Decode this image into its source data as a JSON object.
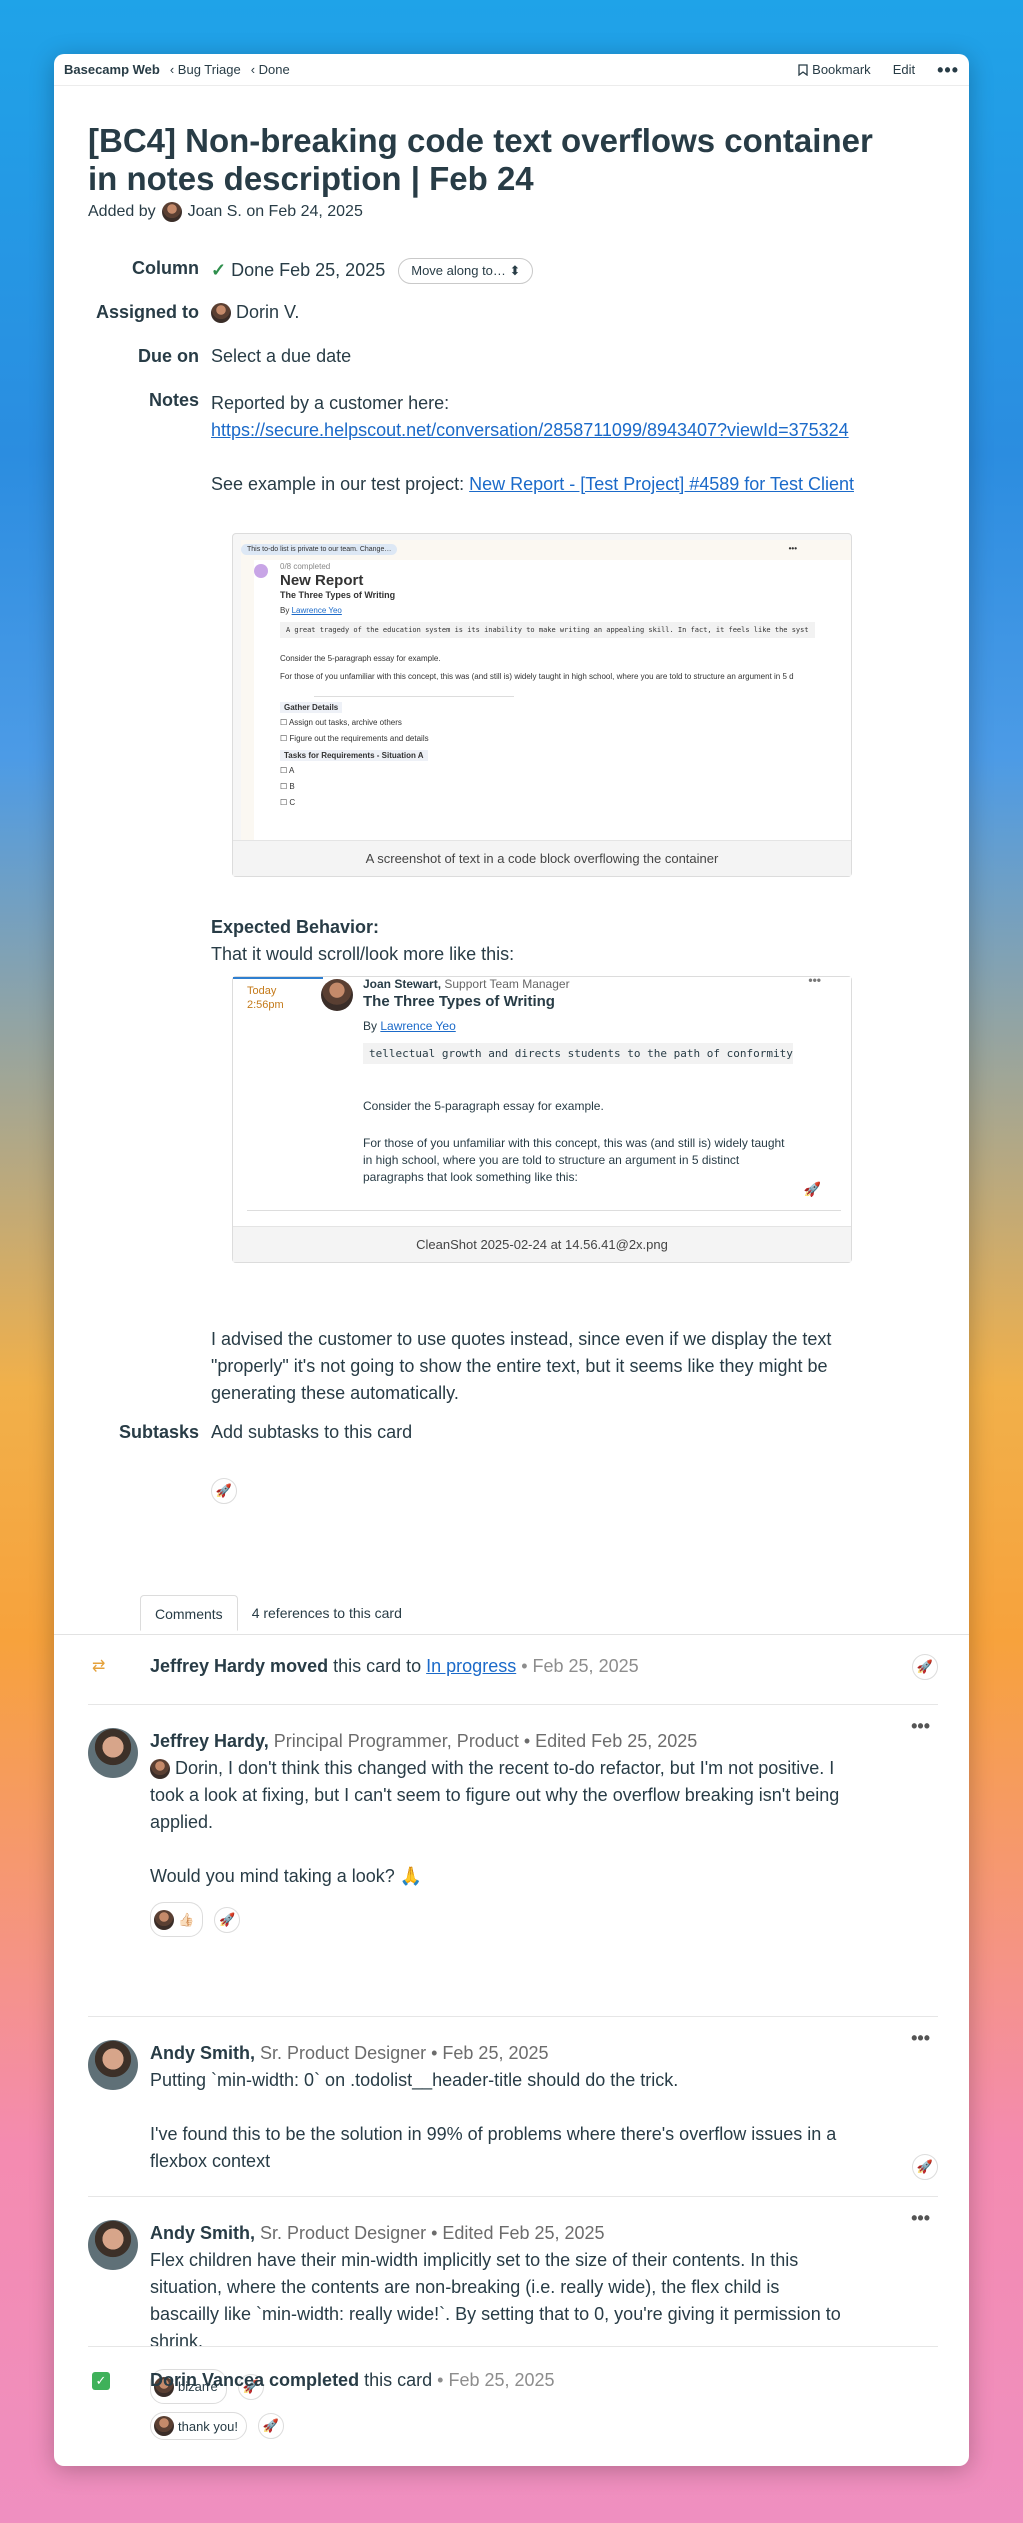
{
  "breadcrumb": {
    "home": "Basecamp Web",
    "project": "‹ Bug Triage",
    "column": "‹ Done"
  },
  "toolbar": {
    "bookmark": "Bookmark",
    "edit": "Edit",
    "more": "•••"
  },
  "card": {
    "title": "[BC4] Non-breaking code text overflows container in notes description | Feb 24",
    "added_by_prefix": "Added by",
    "added_by_rest": "Joan S. on Feb 24, 2025"
  },
  "fields": {
    "column_label": "Column",
    "column_value": "Done Feb 25, 2025",
    "move_button": "Move along to… ⬍",
    "assigned_label": "Assigned to",
    "assigned_value": "Dorin V.",
    "due_label": "Due on",
    "due_placeholder": "Select a due date",
    "notes_label": "Notes",
    "subtasks_label": "Subtasks",
    "subtasks_placeholder": "Add subtasks to this card"
  },
  "notes": {
    "line1": "Reported by a customer here:",
    "link1": "https://secure.helpscout.net/conversation/2858711099/8943407?viewId=375324",
    "line2_prefix": "See example in our test project:",
    "link2": "New Report - [Test Project] #4589 for Test Client",
    "shot1_caption": "A screenshot of text in a code block overflowing the container",
    "expected_heading": "Expected Behavior:",
    "expected_text": "That it would scroll/look more like this:",
    "shot2_caption": "CleanShot 2025-02-24 at 14.56.41@2x.png",
    "closing": "I advised the customer to use quotes instead, since even if we display the text \"properly\" it's not going to show the entire text, but it seems like they might be generating these automatically."
  },
  "shot1": {
    "private_note": "This to-do list is private to our team. Change…",
    "completed": "0/8 completed",
    "list_title": "New Report",
    "doc_title": "The Three Types of Writing",
    "by_label": "By",
    "author": "Lawrence Yeo",
    "code_line": "A great tragedy of the education system is its inability to make writing an appealing skill. In fact, it feels like the syst",
    "para1": "Consider the 5-paragraph essay for example.",
    "para2": "For those of you unfamiliar with this concept, this was (and still is) widely taught in high school, where you are told to structure an argument in 5 d",
    "group1": "Gather Details",
    "todo1": "Assign out tasks, archive others",
    "todo2": "Figure out the requirements and details",
    "group2": "Tasks for Requirements - Situation A",
    "todo3": "A",
    "todo4": "B",
    "todo5": "C"
  },
  "shot2": {
    "date": "Today",
    "time": "2:56pm",
    "author_name": "Joan Stewart,",
    "author_role": "Support Team Manager",
    "doc_title": "The Three Types of Writing",
    "by_label": "By",
    "author": "Lawrence Yeo",
    "code_line": "tellectual growth and directs students to the path of conformity.",
    "para1": "Consider the 5-paragraph essay for example.",
    "para2": "For those of you unfamiliar with this concept, this was (and still is) widely taught in high school, where you are told to structure an argument in 5 distinct paragraphs that look something like this:"
  },
  "tabs": [
    "Comments",
    "4 references to this card"
  ],
  "events": [
    {
      "actor": "Jeffrey Hardy moved",
      "text": "this card to",
      "link": "In progress",
      "date": "• Feb 25, 2025"
    },
    {
      "actor": "Dorin Vancea completed",
      "text": "this card",
      "date": "• Feb 25, 2025"
    }
  ],
  "comments": [
    {
      "name": "Jeffrey Hardy,",
      "role": "Principal Programmer, Product • Edited Feb 25, 2025",
      "p1": "Dorin, I don't think this changed with the recent to-do refactor, but I'm not positive. I took a look at fixing, but I can't seem to figure out why the overflow breaking isn't being applied.",
      "p2": "Would you mind taking a look? 🙏",
      "reaction": "👍🏻"
    },
    {
      "name": "Andy Smith,",
      "role": "Sr. Product Designer • Feb 25, 2025",
      "p1": "Putting `min-width: 0` on .todolist__header-title should do the trick.",
      "p2": "I've found this to be the solution in 99% of problems where there's overflow issues in a flexbox context"
    },
    {
      "name": "Andy Smith,",
      "role": "Sr. Product Designer • Edited Feb 25, 2025",
      "p1": "Flex children have their min-width implicitly set to the size of their contents. In this situation, where the contents are non-breaking (i.e. really wide), the flex child is bascailly like `min-width: really wide!`. By setting that to 0, you're giving it permission to shrink.",
      "reaction": "bizarre"
    }
  ],
  "completed_reaction": "thank you!",
  "icons": {
    "boost": "rocket-icon",
    "check": "✓"
  }
}
